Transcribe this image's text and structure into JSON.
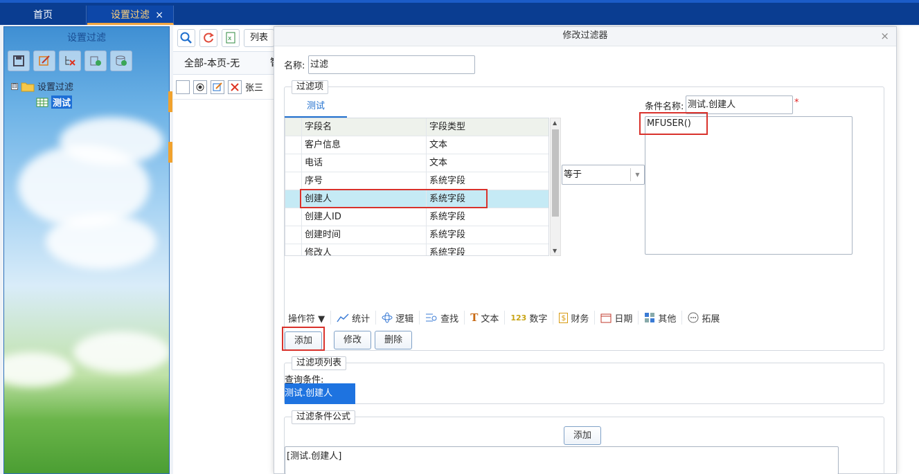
{
  "tabs": {
    "home": "首页",
    "active": "设置过滤",
    "close": "×"
  },
  "left_panel": {
    "title": "设置过滤",
    "tree": {
      "root": "设置过滤",
      "child": "测试",
      "expander": "⊟"
    }
  },
  "main": {
    "toolbar_text": "列表",
    "head_left": "全部-本页-无",
    "head_right": "智",
    "row_text": "张三"
  },
  "modal": {
    "title": "修改过滤器",
    "close": "×",
    "name_label": "名称:",
    "name_value": "过滤",
    "filter_items_legend": "过滤项",
    "tab_label": "测试",
    "columns": {
      "field": "字段名",
      "type": "字段类型"
    },
    "rows": [
      {
        "field": "客户信息",
        "type": "文本"
      },
      {
        "field": "电话",
        "type": "文本"
      },
      {
        "field": "序号",
        "type": "系统字段"
      },
      {
        "field": "创建人",
        "type": "系统字段"
      },
      {
        "field": "创建人ID",
        "type": "系统字段"
      },
      {
        "field": "创建时间",
        "type": "系统字段"
      },
      {
        "field": "修改人",
        "type": "系统字段"
      }
    ],
    "selected_row_index": 3,
    "operator_value": "等于",
    "condition_name_label": "条件名称:",
    "condition_name_value": "测试.创建人",
    "required_mark": "*",
    "condition_text": "MFUSER()",
    "op_toolbar": [
      "操作符 ▼",
      "统计",
      "逻辑",
      "查找",
      "文本",
      "数字",
      "财务",
      "日期",
      "其他",
      "拓展"
    ],
    "btn_add": "添加",
    "btn_modify": "修改",
    "btn_delete": "删除",
    "filter_list_legend": "过滤项列表",
    "query_label": "查询条件:",
    "query_item": "测试.创建人",
    "formula_legend": "过滤条件公式",
    "formula_add": "添加",
    "formula_text": "[测试.创建人]"
  }
}
